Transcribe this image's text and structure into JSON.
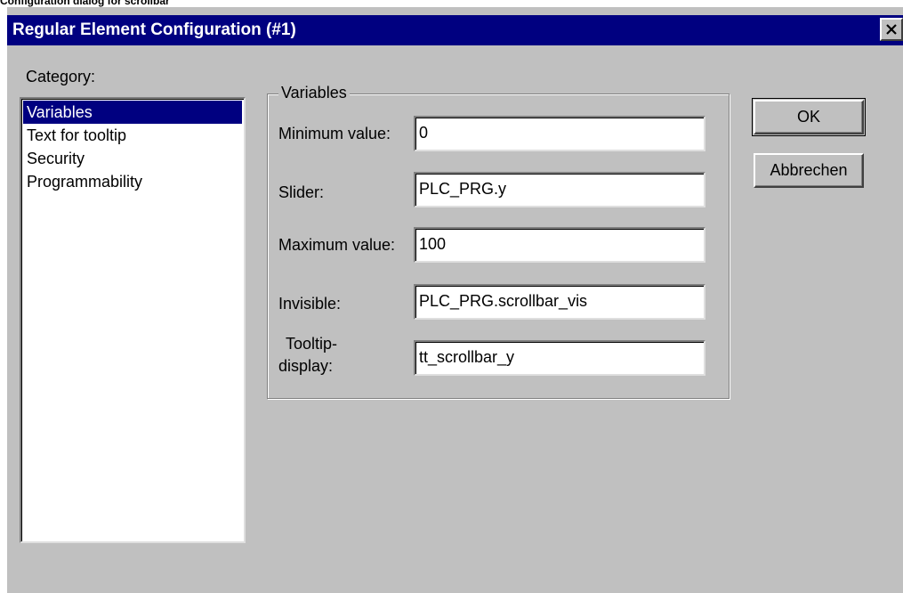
{
  "top_caption": "Configuration dialog for scrollbar",
  "window": {
    "title": "Regular Element Configuration (#1)"
  },
  "category": {
    "label": "Category:",
    "items": [
      "Variables",
      "Text for tooltip",
      "Security",
      "Programmability"
    ],
    "selected_index": 0
  },
  "group": {
    "legend": "Variables",
    "fields": [
      {
        "label": "Minimum value:",
        "value": "0"
      },
      {
        "label": "Slider:",
        "value": "PLC_PRG.y"
      },
      {
        "label": "Maximum value:",
        "value": "100"
      },
      {
        "label": "Invisible:",
        "value": "PLC_PRG.scrollbar_vis"
      },
      {
        "label_line1": "Tooltip-",
        "label_line2": "display:",
        "value": "tt_scrollbar_y"
      }
    ]
  },
  "buttons": {
    "ok": "OK",
    "cancel": "Abbrechen"
  },
  "colors": {
    "titlebar": "#000080",
    "face": "#c0c0c0",
    "selection": "#000080"
  }
}
